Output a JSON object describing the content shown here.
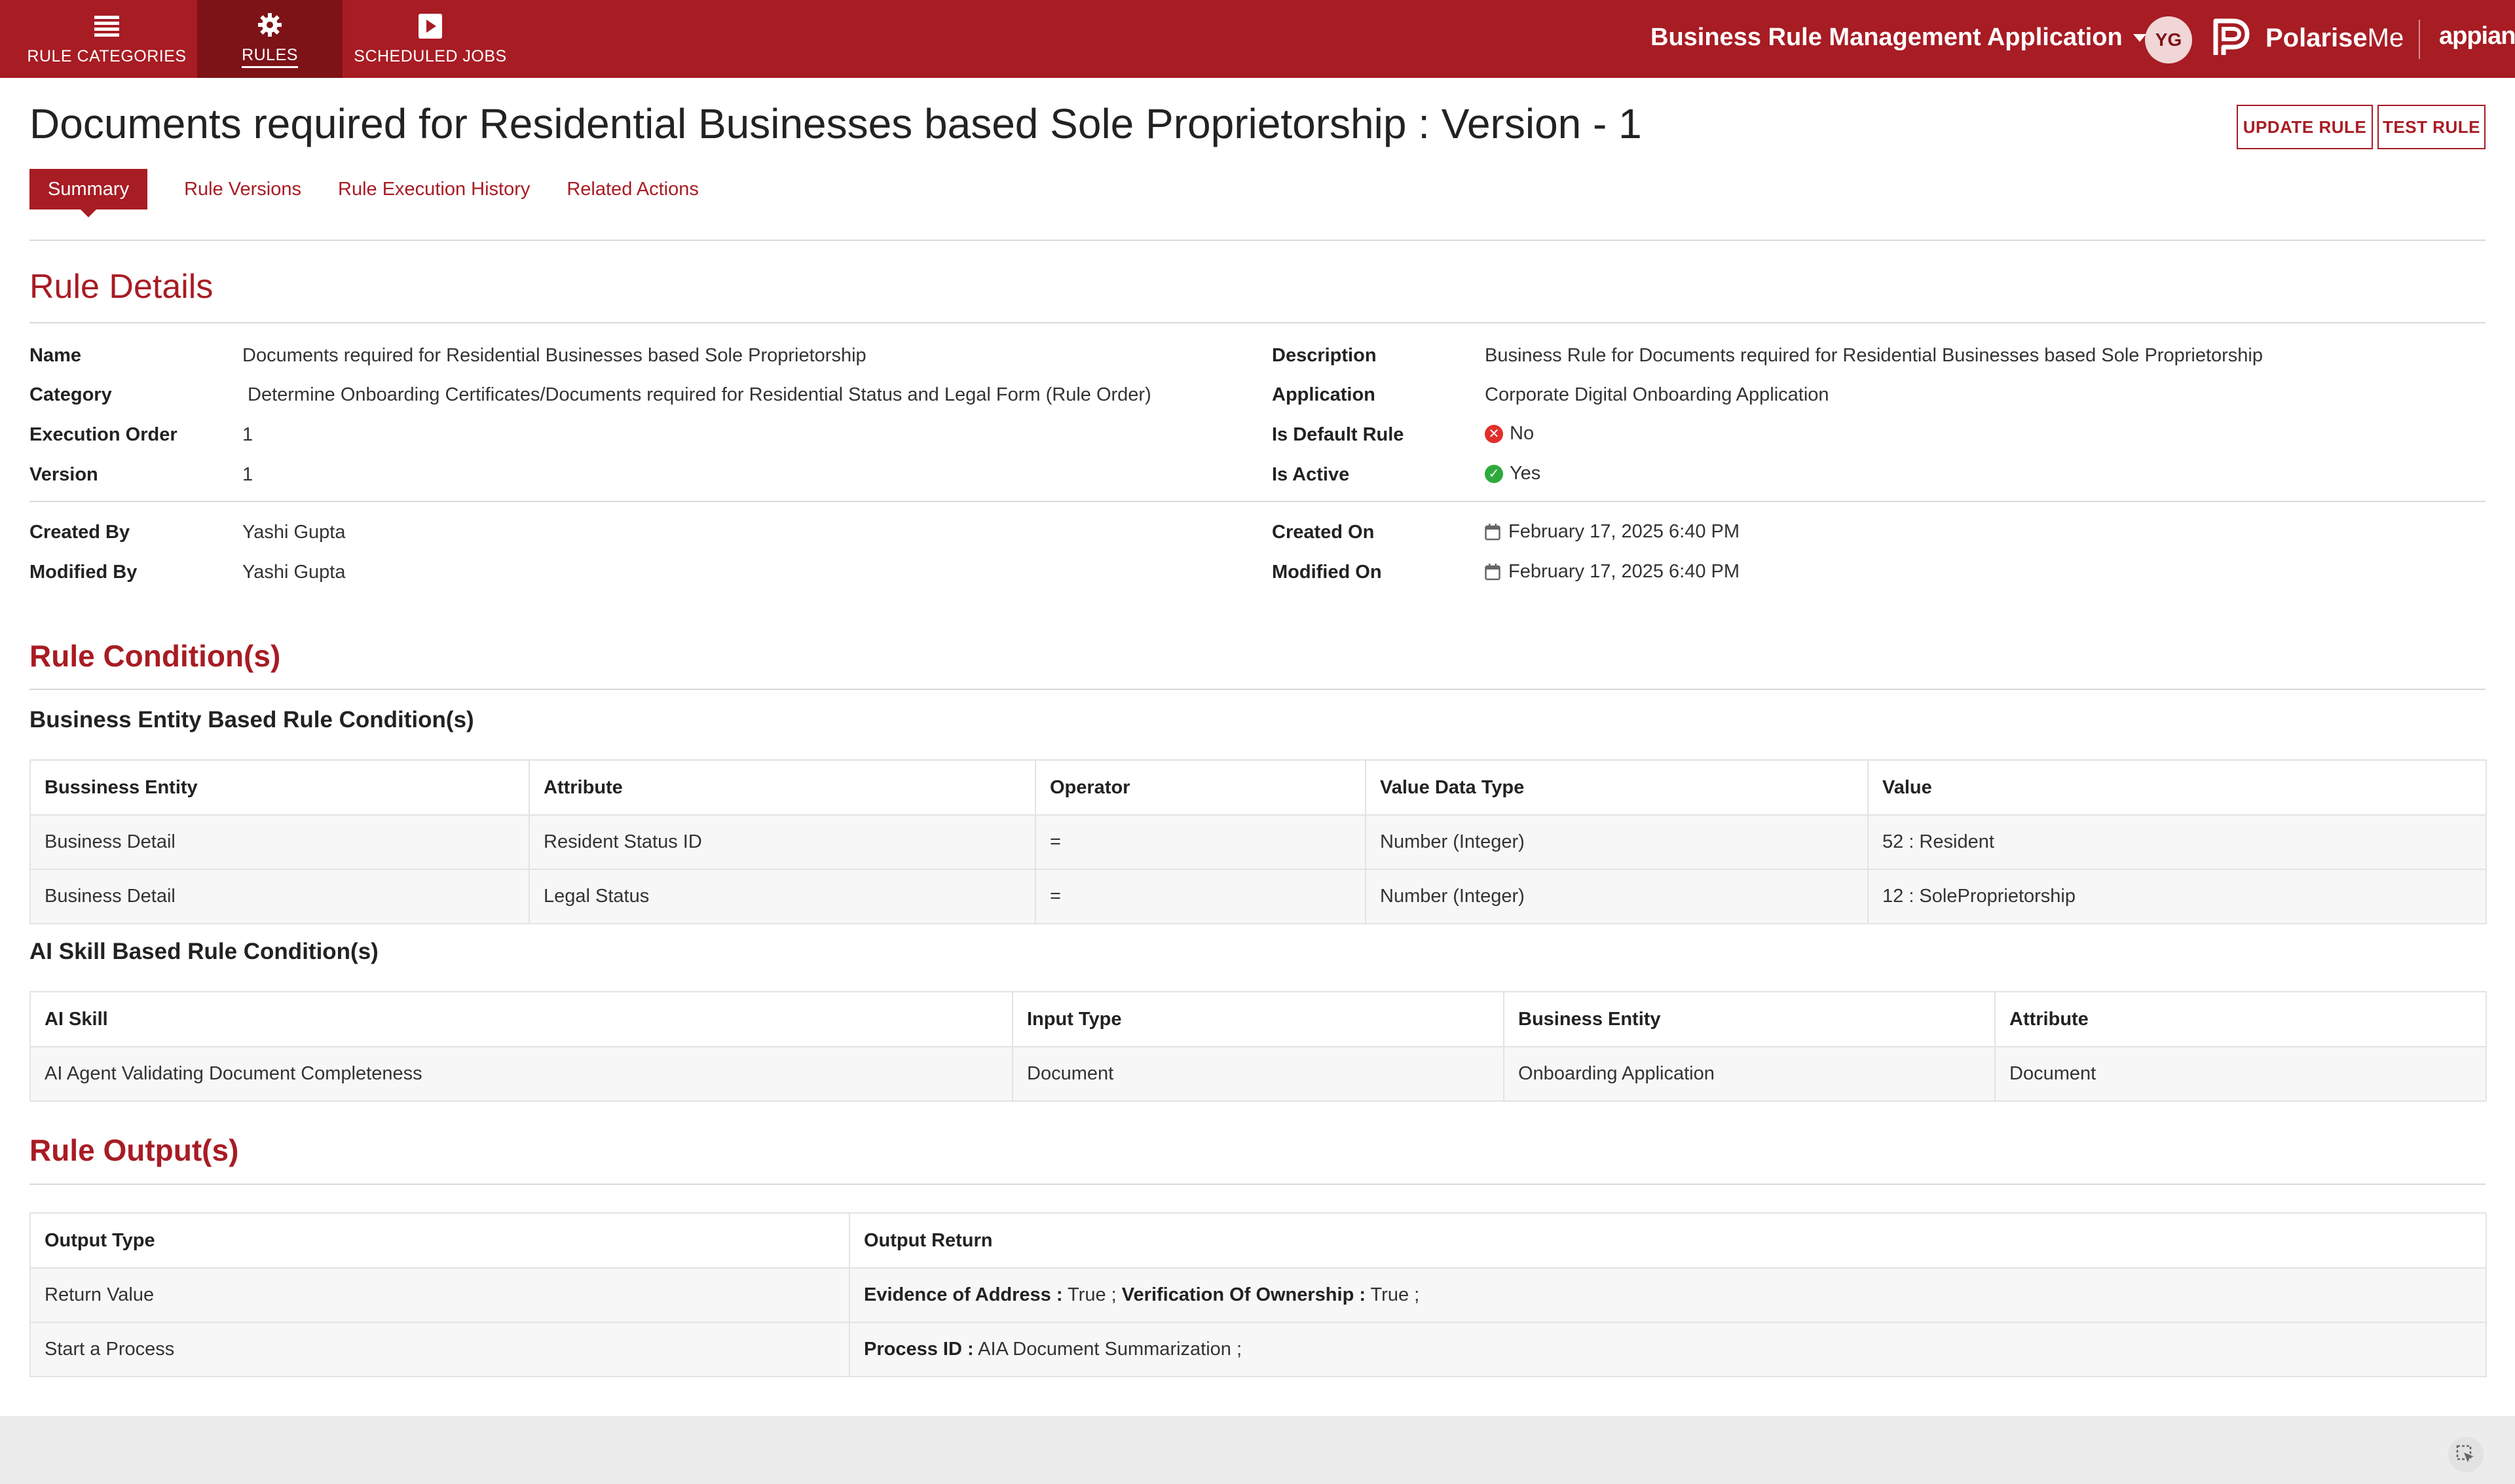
{
  "nav": {
    "tabs": [
      {
        "label": "RULE CATEGORIES",
        "icon": "list-icon"
      },
      {
        "label": "RULES",
        "icon": "gear-icon"
      },
      {
        "label": "SCHEDULED JOBS",
        "icon": "play-icon"
      }
    ],
    "active_tab": "RULES",
    "app_title": "Business Rule Management Application",
    "avatar_initials": "YG",
    "brand_name_bold": "Polarise",
    "brand_name_rest": "Me",
    "platform": "appian"
  },
  "page": {
    "title": "Documents required for Residential Businesses based Sole Proprietorship : Version - 1",
    "update_button": "UPDATE RULE",
    "test_button": "TEST RULE",
    "tabs": [
      "Summary",
      "Rule Versions",
      "Rule Execution History",
      "Related Actions"
    ],
    "active_tab": "Summary"
  },
  "rule_details": {
    "heading": "Rule Details",
    "name_label": "Name",
    "name": "Documents required for Residential Businesses based Sole Proprietorship",
    "category_label": "Category",
    "category": "Determine Onboarding Certificates/Documents required for Residential Status and Legal Form (Rule Order)",
    "execution_order_label": "Execution Order",
    "execution_order": "1",
    "version_label": "Version",
    "version": "1",
    "description_label": "Description",
    "description": "Business Rule for Documents required for Residential Businesses based Sole Proprietorship",
    "application_label": "Application",
    "application": "Corporate Digital Onboarding Application",
    "is_default_label": "Is Default Rule",
    "is_default": "No",
    "is_active_label": "Is Active",
    "is_active": "Yes",
    "created_by_label": "Created By",
    "created_by": "Yashi Gupta",
    "modified_by_label": "Modified By",
    "modified_by": "Yashi Gupta",
    "created_on_label": "Created On",
    "created_on": "February 17, 2025 6:40 PM",
    "modified_on_label": "Modified On",
    "modified_on": "February 17, 2025 6:40 PM"
  },
  "conditions": {
    "heading": "Rule Condition(s)",
    "entity_heading": "Business Entity Based Rule Condition(s)",
    "entity_columns": [
      "Bussiness Entity",
      "Attribute",
      "Operator",
      "Value Data Type",
      "Value"
    ],
    "entity_rows": [
      [
        "Business Detail",
        "Resident Status ID",
        "=",
        "Number (Integer)",
        "52 : Resident"
      ],
      [
        "Business Detail",
        "Legal Status",
        "=",
        "Number (Integer)",
        "12 : SoleProprietorship"
      ]
    ],
    "ai_heading": "AI Skill Based Rule Condition(s)",
    "ai_columns": [
      "AI Skill",
      "Input Type",
      "Business Entity",
      "Attribute"
    ],
    "ai_rows": [
      [
        "AI Agent Validating Document Completeness",
        "Document",
        "Onboarding Application",
        "Document"
      ]
    ]
  },
  "outputs": {
    "heading": "Rule Output(s)",
    "columns": [
      "Output Type",
      "Output Return"
    ],
    "rows": [
      {
        "type": "Return Value",
        "k1": "Evidence of Address :",
        "v1": " True ; ",
        "k2": "Verification Of Ownership :",
        "v2": " True ;"
      },
      {
        "type": "Start a Process",
        "k1": "Process ID :",
        "v1": " AIA Document Summarization ;"
      }
    ]
  },
  "colors": {
    "brand_red": "#a81c24",
    "brand_dark": "#7d1217",
    "success": "#2eaa3c",
    "error": "#e0302b"
  }
}
